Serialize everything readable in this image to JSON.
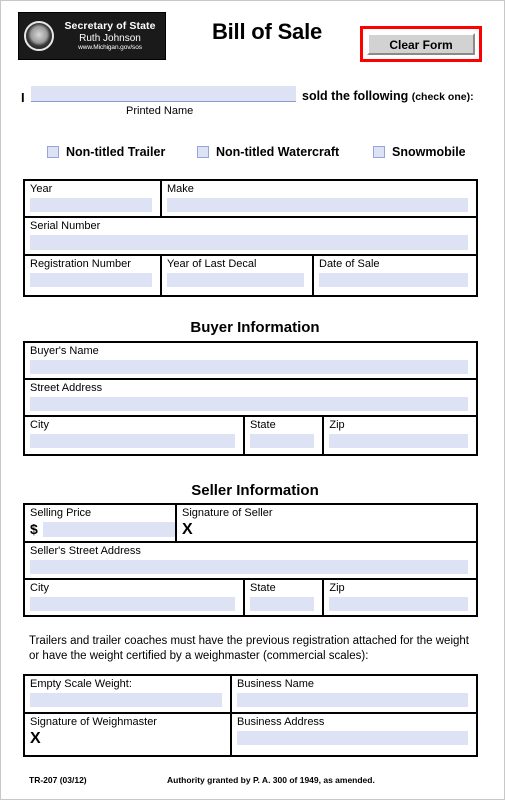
{
  "header": {
    "logo": {
      "line1": "Secretary of State",
      "line2": "Ruth Johnson",
      "line3": "www.Michigan.gov/sos",
      "seal_icon": "state-seal-icon"
    },
    "title": "Bill of Sale",
    "clear_button": "Clear Form",
    "clear_button_border_color": "#ff0000"
  },
  "intro": {
    "i_label": "I",
    "name_value": "",
    "name_placeholder": "",
    "tail_bold": "sold the following ",
    "tail_small": "(check one):",
    "printed_name_caption": "Printed Name"
  },
  "type_options": [
    {
      "label": "Non-titled Trailer",
      "checked": false
    },
    {
      "label": "Non-titled Watercraft",
      "checked": false
    },
    {
      "label": "Snowmobile",
      "checked": false
    }
  ],
  "vehicle_table": {
    "rows": [
      [
        {
          "label": "Year",
          "value": ""
        },
        {
          "label": "Make",
          "value": ""
        }
      ],
      [
        {
          "label": "Serial Number",
          "value": ""
        }
      ],
      [
        {
          "label": "Registration Number",
          "value": ""
        },
        {
          "label": "Year of Last Decal",
          "value": ""
        },
        {
          "label": "Date of Sale",
          "value": ""
        }
      ]
    ]
  },
  "buyer": {
    "heading": "Buyer Information",
    "rows": [
      [
        {
          "label": "Buyer's Name",
          "value": ""
        }
      ],
      [
        {
          "label": "Street Address",
          "value": ""
        }
      ],
      [
        {
          "label": "City",
          "value": ""
        },
        {
          "label": "State",
          "value": ""
        },
        {
          "label": "Zip",
          "value": ""
        }
      ]
    ]
  },
  "seller": {
    "heading": "Seller Information",
    "selling_price_label": "Selling Price",
    "selling_price_currency": "$",
    "selling_price_value": "",
    "signature_label": "Signature of Seller",
    "signature_mark": "X",
    "street_label": "Seller's Street Address",
    "street_value": "",
    "city_label": "City",
    "city_value": "",
    "state_label": "State",
    "state_value": "",
    "zip_label": "Zip",
    "zip_value": ""
  },
  "weigh": {
    "note": "Trailers and trailer coaches must have the previous registration attached for the weight or have the weight certified by a weighmaster (commercial scales):",
    "empty_scale_label": "Empty Scale Weight:",
    "empty_scale_value": "",
    "business_name_label": "Business Name",
    "business_name_value": "",
    "signature_label": "Signature of Weighmaster",
    "signature_mark": "X",
    "business_address_label": "Business Address",
    "business_address_value": ""
  },
  "footer": {
    "form_code": "TR-207 (03/12)",
    "authority": "Authority granted by P. A. 300 of 1949, as amended."
  },
  "colors": {
    "field_fill": "#dde2f5",
    "rule": "#000000",
    "accent_red": "#ff0000"
  }
}
